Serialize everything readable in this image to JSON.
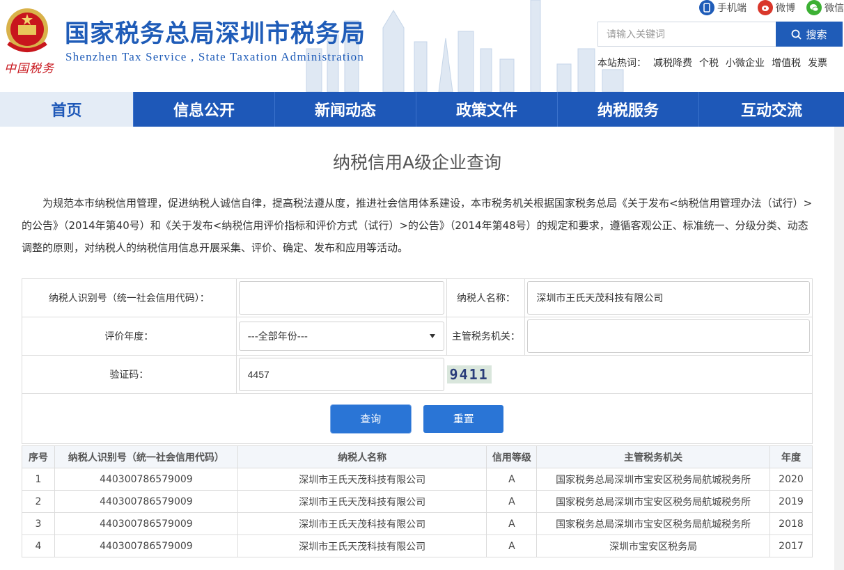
{
  "header": {
    "brand_script": "中国税务",
    "title": "国家税务总局深圳市税务局",
    "subtitle": "Shenzhen  Tax  Service ,  State Taxation  Administration",
    "top_links": [
      {
        "label": "手机端",
        "icon": "mobile-icon",
        "color": "#1f5cb8"
      },
      {
        "label": "微博",
        "icon": "weibo-icon",
        "color": "#d9372b"
      },
      {
        "label": "微信",
        "icon": "wechat-icon",
        "color": "#3cb034"
      }
    ],
    "search": {
      "placeholder": "请输入关键词",
      "button_label": "搜索"
    },
    "hot": {
      "label": "本站热词：",
      "items": [
        "减税降费",
        "个税",
        "小微企业",
        "增值税",
        "发票"
      ]
    }
  },
  "nav": {
    "items": [
      {
        "label": "首页",
        "active": true
      },
      {
        "label": "信息公开"
      },
      {
        "label": "新闻动态"
      },
      {
        "label": "政策文件"
      },
      {
        "label": "纳税服务"
      },
      {
        "label": "互动交流"
      }
    ]
  },
  "page": {
    "title": "纳税信用A级企业查询",
    "intro": "为规范本市纳税信用管理，促进纳税人诚信自律，提高税法遵从度，推进社会信用体系建设，本市税务机关根据国家税务总局《关于发布<纳税信用管理办法（试行）>的公告》（2014年第40号）和《关于发布<纳税信用评价指标和评价方式（试行）>的公告》（2014年第48号）的规定和要求，遵循客观公正、标准统一、分级分类、动态调整的原则，对纳税人的纳税信用信息开展采集、评价、确定、发布和应用等活动。"
  },
  "form": {
    "taxpayer_id_label": "纳税人识别号（统一社会信用代码）：",
    "taxpayer_id_value": "",
    "taxpayer_name_label": "纳税人名称：",
    "taxpayer_name_value": "深圳市王氏天茂科技有限公司",
    "year_label": "评价年度：",
    "year_selected": "---全部年份---",
    "authority_label": "主管税务机关：",
    "authority_value": "",
    "captcha_label": "验证码：",
    "captcha_value": "4457",
    "captcha_image_text": "9411",
    "query_button": "查询",
    "reset_button": "重置"
  },
  "results": {
    "columns": [
      "序号",
      "纳税人识别号（统一社会信用代码）",
      "纳税人名称",
      "信用等级",
      "主管税务机关",
      "年度"
    ],
    "rows": [
      [
        "1",
        "440300786579009",
        "深圳市王氏天茂科技有限公司",
        "A",
        "国家税务总局深圳市宝安区税务局航城税务所",
        "2020"
      ],
      [
        "2",
        "440300786579009",
        "深圳市王氏天茂科技有限公司",
        "A",
        "国家税务总局深圳市宝安区税务局航城税务所",
        "2019"
      ],
      [
        "3",
        "440300786579009",
        "深圳市王氏天茂科技有限公司",
        "A",
        "国家税务总局深圳市宝安区税务局航城税务所",
        "2018"
      ],
      [
        "4",
        "440300786579009",
        "深圳市王氏天茂科技有限公司",
        "A",
        "深圳市宝安区税务局",
        "2017"
      ]
    ]
  },
  "colors": {
    "brand_blue": "#1f5cb8",
    "nav_blue": "#1e58b8",
    "button_blue": "#2a75d6"
  }
}
